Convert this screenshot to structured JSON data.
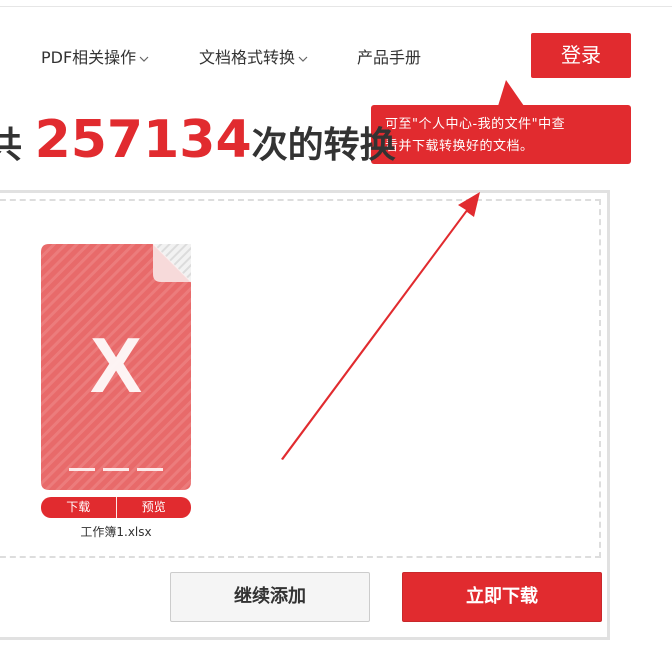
{
  "nav": {
    "items": [
      {
        "label": "PDF相关操作",
        "has_dropdown": true
      },
      {
        "label": "文档格式转换",
        "has_dropdown": true
      },
      {
        "label": "产品手册",
        "has_dropdown": false
      }
    ],
    "login_label": "登录"
  },
  "tooltip": {
    "line1": "可至\"个人中心-我的文件\"中查",
    "line2": "看并下载转换好的文档。"
  },
  "headline": {
    "prefix": "共",
    "count": "257134",
    "suffix": "次的转换"
  },
  "file": {
    "icon_letter": "X",
    "icon": "excel-file-icon",
    "download_label": "下载",
    "preview_label": "预览",
    "name": "工作簿1.xlsx"
  },
  "actions": {
    "continue_label": "继续添加",
    "download_label": "立即下载"
  },
  "colors": {
    "accent": "#e12b2f",
    "file_card": "#e86a6a",
    "text": "#333333"
  }
}
